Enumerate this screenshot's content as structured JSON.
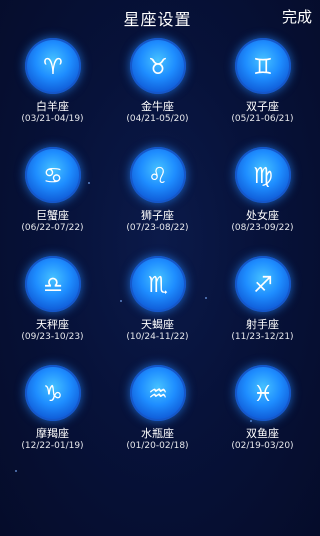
{
  "header": {
    "title": "星座设置",
    "done_label": "完成"
  },
  "signs": [
    {
      "name": "白羊座",
      "range": "(03/21-04/19)",
      "icon": "aries-icon",
      "glyph": "♈"
    },
    {
      "name": "金牛座",
      "range": "(04/21-05/20)",
      "icon": "taurus-icon",
      "glyph": "♉"
    },
    {
      "name": "双子座",
      "range": "(05/21-06/21)",
      "icon": "gemini-icon",
      "glyph": "♊"
    },
    {
      "name": "巨蟹座",
      "range": "(06/22-07/22)",
      "icon": "cancer-icon",
      "glyph": "♋"
    },
    {
      "name": "狮子座",
      "range": "(07/23-08/22)",
      "icon": "leo-icon",
      "glyph": "♌"
    },
    {
      "name": "处女座",
      "range": "(08/23-09/22)",
      "icon": "virgo-icon",
      "glyph": "♍"
    },
    {
      "name": "天秤座",
      "range": "(09/23-10/23)",
      "icon": "libra-icon",
      "glyph": "♎"
    },
    {
      "name": "天蝎座",
      "range": "(10/24-11/22)",
      "icon": "scorpio-icon",
      "glyph": "♏"
    },
    {
      "name": "射手座",
      "range": "(11/23-12/21)",
      "icon": "sagittarius-icon",
      "glyph": "♐"
    },
    {
      "name": "摩羯座",
      "range": "(12/22-01/19)",
      "icon": "capricorn-icon",
      "glyph": "♑"
    },
    {
      "name": "水瓶座",
      "range": "(01/20-02/18)",
      "icon": "aquarius-icon",
      "glyph": "♒"
    },
    {
      "name": "双鱼座",
      "range": "(02/19-03/20)",
      "icon": "pisces-icon",
      "glyph": "♓"
    }
  ],
  "colors": {
    "background": "#07123a",
    "icon_blue": "#1e8dff",
    "text": "#ffffff"
  }
}
